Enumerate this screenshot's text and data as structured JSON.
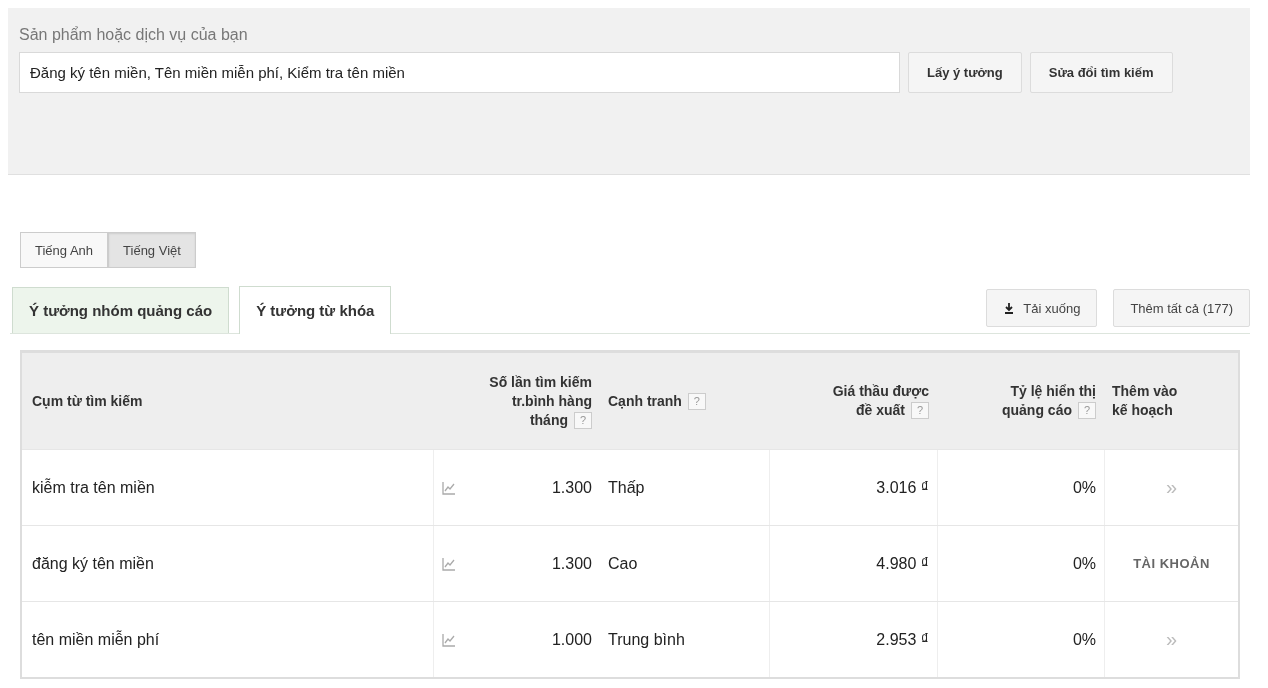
{
  "search_panel": {
    "label": "Sản phẩm hoặc dịch vụ của bạn",
    "value": "Đăng ký tên miền, Tên miền miễn phí, Kiểm tra tên miền",
    "buttons": [
      "Lấy ý tưởng",
      "Sửa đổi tìm kiếm"
    ]
  },
  "languages": [
    {
      "label": "Tiếng Anh",
      "selected": false
    },
    {
      "label": "Tiếng Việt",
      "selected": true
    }
  ],
  "tabs": [
    {
      "label": "Ý tưởng nhóm quảng cáo",
      "selected": false
    },
    {
      "label": "Ý tưởng từ khóa",
      "selected": true
    }
  ],
  "actions": [
    {
      "label": "Tải xuống",
      "kind": "download"
    },
    {
      "label": "Thêm tất cả (177)",
      "kind": "plain"
    }
  ],
  "table": {
    "columns": [
      {
        "lines": [
          "Cụm từ tìm kiếm"
        ]
      },
      {
        "lines": [
          "Số lần tìm kiếm",
          "tr.bình hàng",
          "tháng"
        ],
        "help": "?"
      },
      {
        "lines": [
          "Cạnh tranh"
        ],
        "help": "?"
      },
      {
        "lines": [
          "Giá thầu được",
          "đề xuất"
        ],
        "help": "?"
      },
      {
        "lines": [
          "Tỷ lệ hiển thị",
          "quảng cáo"
        ],
        "help": "?"
      },
      {
        "lines": [
          "Thêm vào",
          "kế hoạch"
        ]
      }
    ],
    "rows": [
      {
        "phrase": "kiễm tra tên miền",
        "searches": "1.300",
        "competition": "Thấp",
        "bid": "3.016 ₫",
        "share": "0%",
        "add": {
          "kind": "arrow",
          "text": "»"
        }
      },
      {
        "phrase": "đăng ký tên miền",
        "searches": "1.300",
        "competition": "Cao",
        "bid": "4.980 ₫",
        "share": "0%",
        "add": {
          "kind": "label",
          "text": "TÀI KHOẢN"
        }
      },
      {
        "phrase": "tên miền miễn phí",
        "searches": "1.000",
        "competition": "Trung bình",
        "bid": "2.953 ₫",
        "share": "0%",
        "add": {
          "kind": "arrow",
          "text": "»"
        }
      }
    ]
  }
}
